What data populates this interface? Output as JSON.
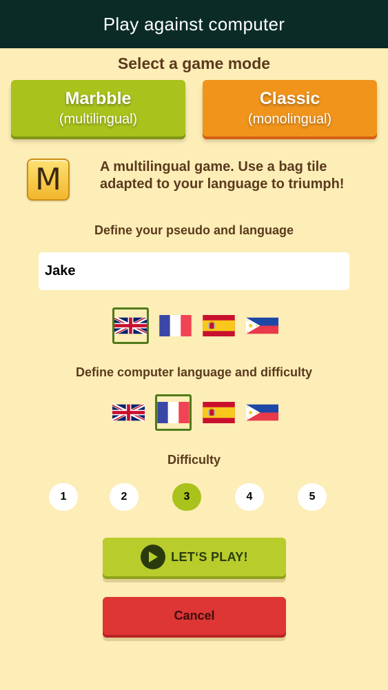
{
  "header": {
    "title": "Play against computer"
  },
  "mode_section": {
    "title": "Select a game mode",
    "modes": [
      {
        "name": "Marbble",
        "subtitle": "(multilingual)",
        "color": "#a9c21c",
        "selected": true
      },
      {
        "name": "Classic",
        "subtitle": "(monolingual)",
        "color": "#f0941c",
        "selected": false
      }
    ],
    "tile_letter": "M",
    "description": "A multilingual game. Use a bag tile adapted to your language to triumph!"
  },
  "player": {
    "title": "Define your pseudo and language",
    "pseudo_value": "Jake",
    "languages": [
      {
        "flag": "uk-flag-icon",
        "selected": true
      },
      {
        "flag": "france-flag-icon",
        "selected": false
      },
      {
        "flag": "spain-flag-icon",
        "selected": false
      },
      {
        "flag": "philippines-flag-icon",
        "selected": false
      }
    ]
  },
  "computer": {
    "title": "Define computer language and difficulty",
    "languages": [
      {
        "flag": "uk-flag-icon",
        "selected": false
      },
      {
        "flag": "france-flag-icon",
        "selected": true
      },
      {
        "flag": "spain-flag-icon",
        "selected": false
      },
      {
        "flag": "philippines-flag-icon",
        "selected": false
      }
    ]
  },
  "difficulty": {
    "title": "Difficulty",
    "levels": [
      "1",
      "2",
      "3",
      "4",
      "5"
    ],
    "selected": "3"
  },
  "actions": {
    "play_label": "LET‘S PLAY!",
    "cancel_label": "Cancel"
  },
  "colors": {
    "background": "#fdedb6",
    "header": "#0b2b27",
    "accent_green": "#a9c21c",
    "accent_orange": "#f0941c",
    "cancel_red": "#de3535",
    "selection_border": "#4f7a1a"
  }
}
